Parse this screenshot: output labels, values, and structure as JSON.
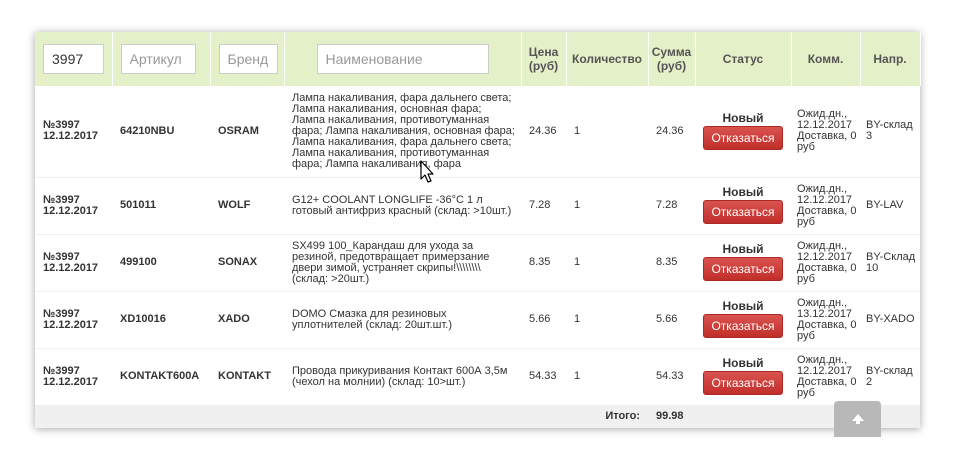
{
  "filters": {
    "order_value": "3997",
    "article_placeholder": "Артикул",
    "brand_placeholder": "Бренд",
    "name_placeholder": "Наименование"
  },
  "headers": {
    "price": "Цена (руб)",
    "quantity": "Количество",
    "sum": "Сумма (руб)",
    "status": "Статус",
    "comment": "Комм.",
    "direction": "Напр."
  },
  "rows": [
    {
      "order": "№3997",
      "date": "12.12.2017",
      "article": "64210NBU",
      "brand": "OSRAM",
      "name": "Лампа накаливания, фара дальнего света; Лампа накаливания, основная фара; Лампа накаливания, противотуманная фара; Лампа накаливания, основная фара; Лампа накаливания, фара дальнего света; Лампа накаливания, противотуманная фара; Лампа накаливания, фара",
      "price": "24.36",
      "quantity": "1",
      "sum": "24.36",
      "status": "Новый",
      "action": "Отказаться",
      "comment": "Ожид.дн., 12.12.2017 Доставка, 0 руб",
      "direction": "BY-склад 3"
    },
    {
      "order": "№3997",
      "date": "12.12.2017",
      "article": "501011",
      "brand": "WOLF",
      "name": "G12+ COOLANT LONGLIFE -36°C 1 л готовый антифриз красный (склад: >10шт.)",
      "price": "7.28",
      "quantity": "1",
      "sum": "7.28",
      "status": "Новый",
      "action": "Отказаться",
      "comment": "Ожид.дн., 12.12.2017 Доставка, 0 руб",
      "direction": "BY-LAV"
    },
    {
      "order": "№3997",
      "date": "12.12.2017",
      "article": "499100",
      "brand": "SONAX",
      "name": "SX499 100_Карандаш для ухода за резиной, предотвращает примерзание двери зимой, устраняет скрипы!\\\\\\\\\\\\\\\\ (склад: >20шт.)",
      "price": "8.35",
      "quantity": "1",
      "sum": "8.35",
      "status": "Новый",
      "action": "Отказаться",
      "comment": "Ожид.дн., 12.12.2017 Доставка, 0 руб",
      "direction": "BY-Склад 10"
    },
    {
      "order": "№3997",
      "date": "12.12.2017",
      "article": "XD10016",
      "brand": "XADO",
      "name": "DOMO Смазка для резиновых уплотнителей (склад: 20шт.шт.)",
      "price": "5.66",
      "quantity": "1",
      "sum": "5.66",
      "status": "Новый",
      "action": "Отказаться",
      "comment": "Ожид.дн., 13.12.2017 Доставка, 0 руб",
      "direction": "BY-XADO"
    },
    {
      "order": "№3997",
      "date": "12.12.2017",
      "article": "KONTAKT600A",
      "brand": "KONTAKT",
      "name": "Провода прикуривания Контакт 600А 3,5м (чехол на молнии) (склад: 10>шт.)",
      "price": "54.33",
      "quantity": "1",
      "sum": "54.33",
      "status": "Новый",
      "action": "Отказаться",
      "comment": "Ожид.дн., 12.12.2017 Доставка, 0 руб",
      "direction": "BY-склад 2"
    }
  ],
  "footer": {
    "total_label": "Итого:",
    "total_value": "99.98"
  },
  "icons": {
    "scroll_top": "arrow-up-icon",
    "cursor": "mouse-pointer-icon"
  },
  "colors": {
    "header_bg": "#e4f0c8",
    "cancel_button": "#c9302c"
  }
}
